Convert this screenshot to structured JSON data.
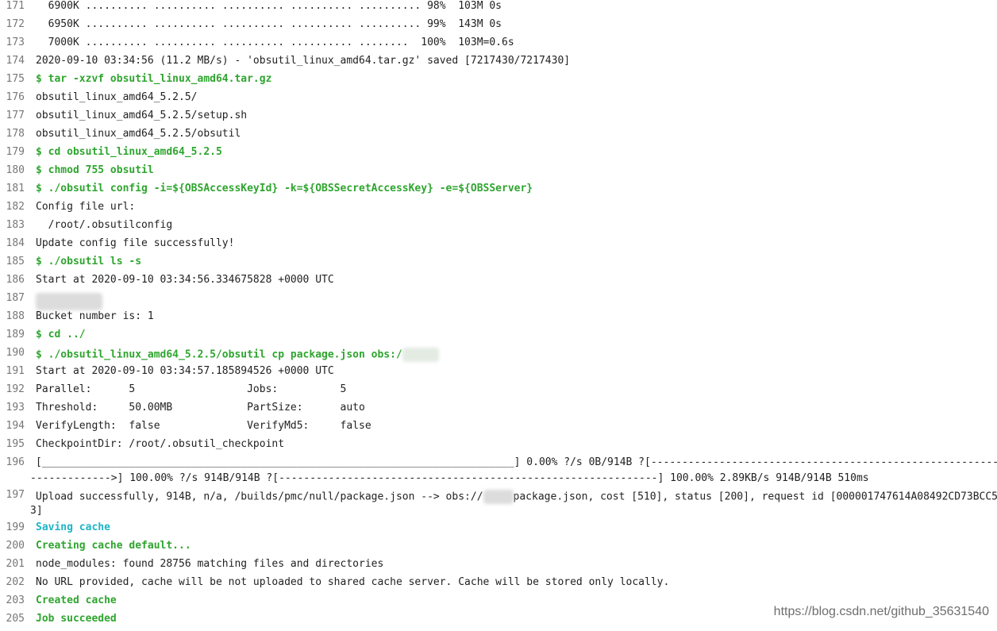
{
  "terminal": {
    "lines": [
      {
        "n": "171",
        "text": "  6900K .......... .......... .......... .......... .......... 98%  103M 0s",
        "style": "out"
      },
      {
        "n": "172",
        "text": "  6950K .......... .......... .......... .......... .......... 99%  143M 0s",
        "style": "out"
      },
      {
        "n": "173",
        "text": "  7000K .......... .......... .......... .......... ........  100%  103M=0.6s",
        "style": "out"
      },
      {
        "n": "174",
        "text": "2020-09-10 03:34:56 (11.2 MB/s) - 'obsutil_linux_amd64.tar.gz' saved [7217430/7217430]",
        "style": "out"
      },
      {
        "n": "175",
        "text": "$ tar -xzvf obsutil_linux_amd64.tar.gz",
        "style": "cmd"
      },
      {
        "n": "176",
        "text": "obsutil_linux_amd64_5.2.5/",
        "style": "out"
      },
      {
        "n": "177",
        "text": "obsutil_linux_amd64_5.2.5/setup.sh",
        "style": "out"
      },
      {
        "n": "178",
        "text": "obsutil_linux_amd64_5.2.5/obsutil",
        "style": "out"
      },
      {
        "n": "179",
        "text": "$ cd obsutil_linux_amd64_5.2.5",
        "style": "cmd"
      },
      {
        "n": "180",
        "text": "$ chmod 755 obsutil",
        "style": "cmd"
      },
      {
        "n": "181",
        "text": "$ ./obsutil config -i=${OBSAccessKeyId} -k=${OBSSecretAccessKey} -e=${OBSServer}",
        "style": "cmd"
      },
      {
        "n": "182",
        "text": "Config file url:",
        "style": "out"
      },
      {
        "n": "183",
        "text": "  /root/.obsutilconfig",
        "style": "out"
      },
      {
        "n": "184",
        "text": "Update config file successfully!",
        "style": "out"
      },
      {
        "n": "185",
        "text": "$ ./obsutil ls -s",
        "style": "cmd"
      },
      {
        "n": "186",
        "text": "Start at 2020-09-10 03:34:56.334675828 +0000 UTC",
        "style": "out"
      },
      {
        "n": "187",
        "text": "",
        "style": "out",
        "blur": "start"
      },
      {
        "n": "188",
        "text": "Bucket number is: 1",
        "style": "out"
      },
      {
        "n": "189",
        "text": "$ cd ../",
        "style": "cmd"
      },
      {
        "n": "190",
        "text": "$ ./obsutil_linux_amd64_5.2.5/obsutil cp package.json obs:/",
        "style": "cmd",
        "blur": "end"
      },
      {
        "n": "191",
        "text": "Start at 2020-09-10 03:34:57.185894526 +0000 UTC",
        "style": "out"
      },
      {
        "n": "192",
        "text": "Parallel:      5                  Jobs:          5",
        "style": "out"
      },
      {
        "n": "193",
        "text": "Threshold:     50.00MB            PartSize:      auto",
        "style": "out"
      },
      {
        "n": "194",
        "text": "VerifyLength:  false              VerifyMd5:     false",
        "style": "out"
      },
      {
        "n": "195",
        "text": "CheckpointDir: /root/.obsutil_checkpoint",
        "style": "out"
      },
      {
        "n": "196",
        "text": "[____________________________________________________________________________] 0.00% ?/s 0B/914B ?[------------------------------------------------------------",
        "cont": "------------->] 100.00% ?/s 914B/914B ?[-------------------------------------------------------------] 100.00% 2.89KB/s 914B/914B 510ms",
        "style": "out"
      },
      {
        "n": "197",
        "text": "Upload successfully, 914B, n/a, /builds/pmc/null/package.json --> obs://",
        "text2": "package.json, cost [510], status [200], request id [000001747614A08492CD73BCC5",
        "cont": "3]",
        "style": "out",
        "blur": "mid"
      },
      {
        "n": "199",
        "text": "Saving cache",
        "style": "cyan"
      },
      {
        "n": "200",
        "text": "Creating cache default...",
        "style": "cmd"
      },
      {
        "n": "201",
        "text": "node_modules: found 28756 matching files and directories",
        "style": "out"
      },
      {
        "n": "202",
        "text": "No URL provided, cache will be not uploaded to shared cache server. Cache will be stored only locally.",
        "style": "out"
      },
      {
        "n": "203",
        "text": "Created cache",
        "style": "cmd"
      },
      {
        "n": "205",
        "text": "Job succeeded",
        "style": "cmd"
      }
    ]
  },
  "watermark": "https://blog.csdn.net/github_35631540",
  "colors": {
    "command": "#2fa52f",
    "section": "#1db5c5",
    "line_number": "#777777",
    "background": "#ffffff"
  }
}
